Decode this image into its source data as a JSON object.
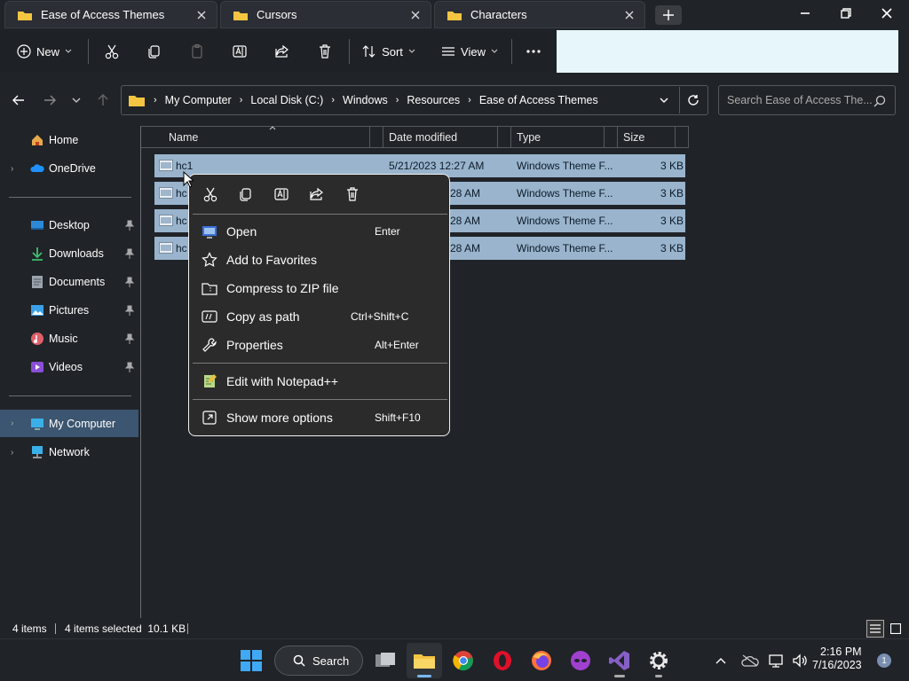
{
  "tabs": [
    {
      "label": "Ease of Access Themes"
    },
    {
      "label": "Cursors"
    },
    {
      "label": "Characters"
    }
  ],
  "toolbar": {
    "new_label": "New",
    "sort_label": "Sort",
    "view_label": "View"
  },
  "address": {
    "crumbs": [
      "My Computer",
      "Local Disk (C:)",
      "Windows",
      "Resources",
      "Ease of Access Themes"
    ]
  },
  "search": {
    "placeholder": "Search Ease of Access The..."
  },
  "nav": {
    "items": [
      {
        "label": "Home"
      },
      {
        "label": "OneDrive"
      },
      {
        "label": "Desktop"
      },
      {
        "label": "Downloads"
      },
      {
        "label": "Documents"
      },
      {
        "label": "Pictures"
      },
      {
        "label": "Music"
      },
      {
        "label": "Videos"
      },
      {
        "label": "My Computer"
      },
      {
        "label": "Network"
      }
    ]
  },
  "columns": {
    "name": "Name",
    "date": "Date modified",
    "type": "Type",
    "size": "Size"
  },
  "files": [
    {
      "name": "hc1",
      "date": "5/21/2023 12:27 AM",
      "type": "Windows Theme F...",
      "size": "3 KB"
    },
    {
      "name": "hc",
      "date": "28 AM",
      "type": "Windows Theme F...",
      "size": "3 KB"
    },
    {
      "name": "hc",
      "date": "28 AM",
      "type": "Windows Theme F...",
      "size": "3 KB"
    },
    {
      "name": "hc",
      "date": "28 AM",
      "type": "Windows Theme F...",
      "size": "3 KB"
    }
  ],
  "context_menu": {
    "items": [
      {
        "label": "Open",
        "shortcut": "Enter"
      },
      {
        "label": "Add to Favorites",
        "shortcut": ""
      },
      {
        "label": "Compress to ZIP file",
        "shortcut": ""
      },
      {
        "label": "Copy as path",
        "shortcut": "Ctrl+Shift+C"
      },
      {
        "label": "Properties",
        "shortcut": "Alt+Enter"
      },
      {
        "label": "Edit with Notepad++",
        "shortcut": ""
      },
      {
        "label": "Show more options",
        "shortcut": "Shift+F10"
      }
    ]
  },
  "status": {
    "items": "4 items",
    "selected": "4 items selected  10.1 KB"
  },
  "taskbar": {
    "search_label": "Search",
    "time": "2:16 PM",
    "date": "7/16/2023",
    "notification_count": "1"
  },
  "colors": {
    "accent": "#99b4cc",
    "nav_selected": "#3c5570",
    "folder": "#f5c542"
  }
}
